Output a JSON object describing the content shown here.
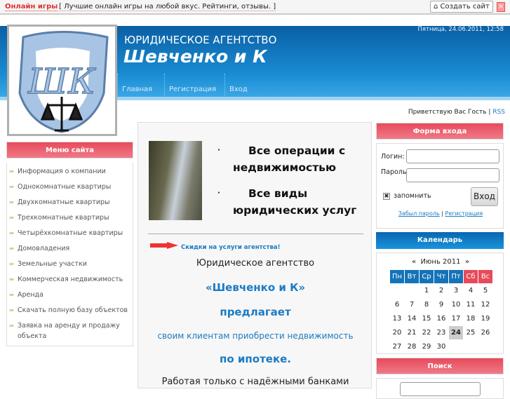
{
  "topbar": {
    "brand": "Онлайн игры",
    "tagline": "[ Лучшие онлайн игры на любой вкус. Рейтинги, отзывы. ]",
    "create_site": "Создать сайт",
    "close": "✕"
  },
  "header": {
    "subtitle": "ЮРИДИЧЕСКОЕ АГЕНТСТВО",
    "title": "Шевченко и К",
    "datetime": "Пятница, 24.06.2011, 12:58",
    "nav": [
      "Главная",
      "Регистрация",
      "Вход"
    ],
    "logo_text": "ШК"
  },
  "greeting": {
    "text": "Приветствую Вас Гость",
    "sep": "|",
    "rss": "RSS"
  },
  "menu": {
    "title": "Меню сайта",
    "items": [
      "Информация о компании",
      "Однокомнатные квартиры",
      "Двухкомнатные квартиры",
      "Трехкомнатные квартиры",
      "Четырёхкомнатные квартиры",
      "Домовладения",
      "Земельные участки",
      "Коммерческая недвижимость",
      "Аренда",
      "Скачать полную базу объектов",
      "Заявка на аренду и продажу объекта"
    ]
  },
  "content": {
    "bullets": [
      "Все операции с недвижимостью",
      "Все виды юридических услуг"
    ],
    "promo": "Скидки на услуги агентства!",
    "line1": "Юридическое агентство",
    "line2": "«Шевченко и К»",
    "line3": "предлагает",
    "line4": "своим клиентам приобрести недвижимость",
    "line5": "по ипотеке.",
    "line6": "Работая только с надёжными банками"
  },
  "login": {
    "title": "Форма входа",
    "login_label": "Логин:",
    "password_label": "Пароль:",
    "login_value": "",
    "password_value": "",
    "remember": "запомнить",
    "submit": "Вход",
    "forgot": "Забыл пароль",
    "register": "Регистрация",
    "sep": "|"
  },
  "calendar": {
    "title": "Календарь",
    "prev": "«",
    "month": "Июнь 2011",
    "next": "»",
    "days": [
      "Пн",
      "Вт",
      "Ср",
      "Чт",
      "Пт",
      "Сб",
      "Вс"
    ],
    "weeks": [
      [
        "",
        "",
        "1",
        "2",
        "3",
        "4",
        "5"
      ],
      [
        "6",
        "7",
        "8",
        "9",
        "10",
        "11",
        "12"
      ],
      [
        "13",
        "14",
        "15",
        "16",
        "17",
        "18",
        "19"
      ],
      [
        "20",
        "21",
        "22",
        "23",
        "24",
        "25",
        "26"
      ],
      [
        "27",
        "28",
        "29",
        "30",
        "",
        "",
        ""
      ]
    ],
    "today": "24"
  },
  "search": {
    "title": "Поиск",
    "value": ""
  }
}
